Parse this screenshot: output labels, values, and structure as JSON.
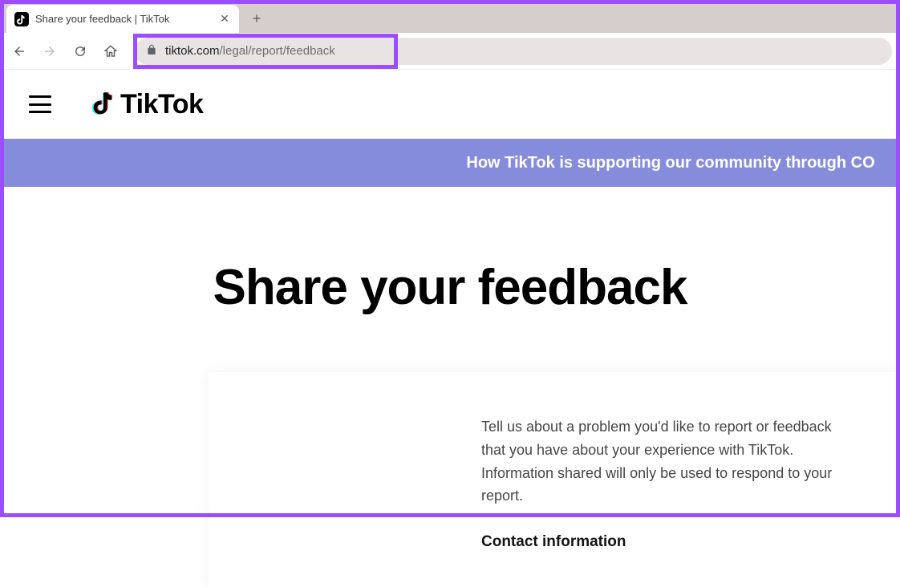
{
  "browser": {
    "tab_title": "Share your feedback | TikTok",
    "url_host": "tiktok.com",
    "url_path": "/legal/report/feedback"
  },
  "header": {
    "logo_text": "TikTok"
  },
  "banner": {
    "text": "How TikTok is supporting our community through CO"
  },
  "page": {
    "title": "Share your feedback",
    "intro": "Tell us about a problem you'd like to report or feedback that you have about your experience with TikTok. Information shared will only be used to respond to your report.",
    "section_heading": "Contact information"
  },
  "colors": {
    "highlight": "#9b4dff",
    "banner_bg": "#868cdc"
  }
}
